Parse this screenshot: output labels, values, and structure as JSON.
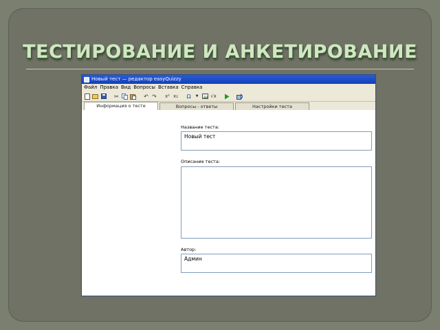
{
  "slide": {
    "title": "ТЕСТИРОВАНИЕ И АНКЕТИРОВАНИЕ"
  },
  "window": {
    "title": "Новый тест — редактор easyQuizzy",
    "menu": [
      "Файл",
      "Правка",
      "Вид",
      "Вопросы",
      "Вставка",
      "Справка"
    ],
    "toolbar_icons": [
      "new-file-icon",
      "open-folder-icon",
      "save-icon",
      "cut-icon",
      "copy-icon",
      "paste-icon",
      "undo-icon",
      "redo-icon",
      "superscript-icon",
      "subscript-icon",
      "omega-icon",
      "dropdown-icon",
      "image-icon",
      "formula-icon",
      "run-icon",
      "preview-icon"
    ],
    "tabs": [
      "Информация о тесте",
      "Вопросы - ответы",
      "Настройки теста"
    ],
    "form": {
      "name_label": "Название теста:",
      "name_value": "Новый тест",
      "description_label": "Описание теста:",
      "description_value": "",
      "author_label": "Автор:",
      "author_value": "Админ"
    }
  }
}
